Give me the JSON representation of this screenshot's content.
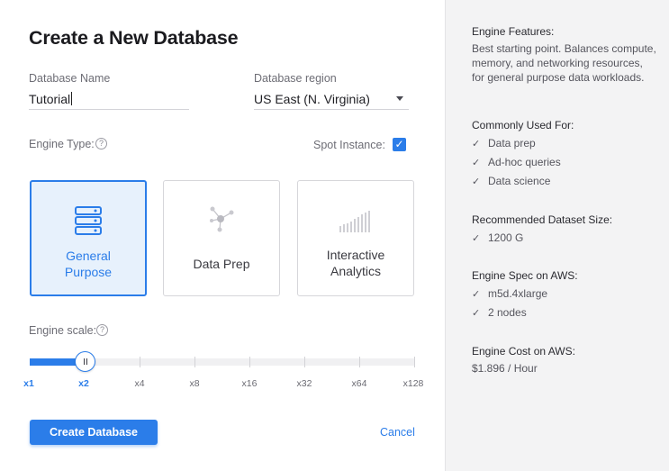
{
  "title": "Create a New Database",
  "database_name": {
    "label": "Database Name",
    "value": "Tutorial"
  },
  "database_region": {
    "label": "Database region",
    "value": "US East (N. Virginia)"
  },
  "engine_type": {
    "label": "Engine Type:",
    "help": "?"
  },
  "spot_instance": {
    "label": "Spot Instance:",
    "checked": true,
    "check_glyph": "✓"
  },
  "engine_cards": [
    {
      "line1": "General",
      "line2": "Purpose",
      "icon": "server-stack-icon",
      "selected": true
    },
    {
      "line1": "Data Prep",
      "line2": "",
      "icon": "network-nodes-icon",
      "selected": false
    },
    {
      "line1": "Interactive",
      "line2": "Analytics",
      "icon": "bar-chart-icon",
      "selected": false
    }
  ],
  "engine_scale": {
    "label": "Engine scale:",
    "help": "?",
    "options": [
      "x1",
      "x2",
      "x4",
      "x8",
      "x16",
      "x32",
      "x64",
      "x128"
    ],
    "selected": "x2"
  },
  "actions": {
    "create_label": "Create Database",
    "cancel_label": "Cancel"
  },
  "sidebar": {
    "features_heading": "Engine Features:",
    "features_text": "Best starting point. Balances compute, memory, and networking resources, for general purpose data workloads.",
    "used_for_heading": "Commonly Used For:",
    "used_for_items": [
      "Data prep",
      "Ad-hoc queries",
      "Data science"
    ],
    "dataset_heading": "Recommended Dataset Size:",
    "dataset_items": [
      "1200 G"
    ],
    "spec_heading": "Engine Spec on AWS:",
    "spec_items": [
      "m5d.4xlarge",
      "2 nodes"
    ],
    "cost_heading": "Engine Cost on AWS:",
    "cost_value": "$1.896 / Hour"
  },
  "colors": {
    "accent": "#2b7de9",
    "selected_card_bg": "#e7f1fc",
    "sidebar_bg": "#f3f3f4"
  }
}
